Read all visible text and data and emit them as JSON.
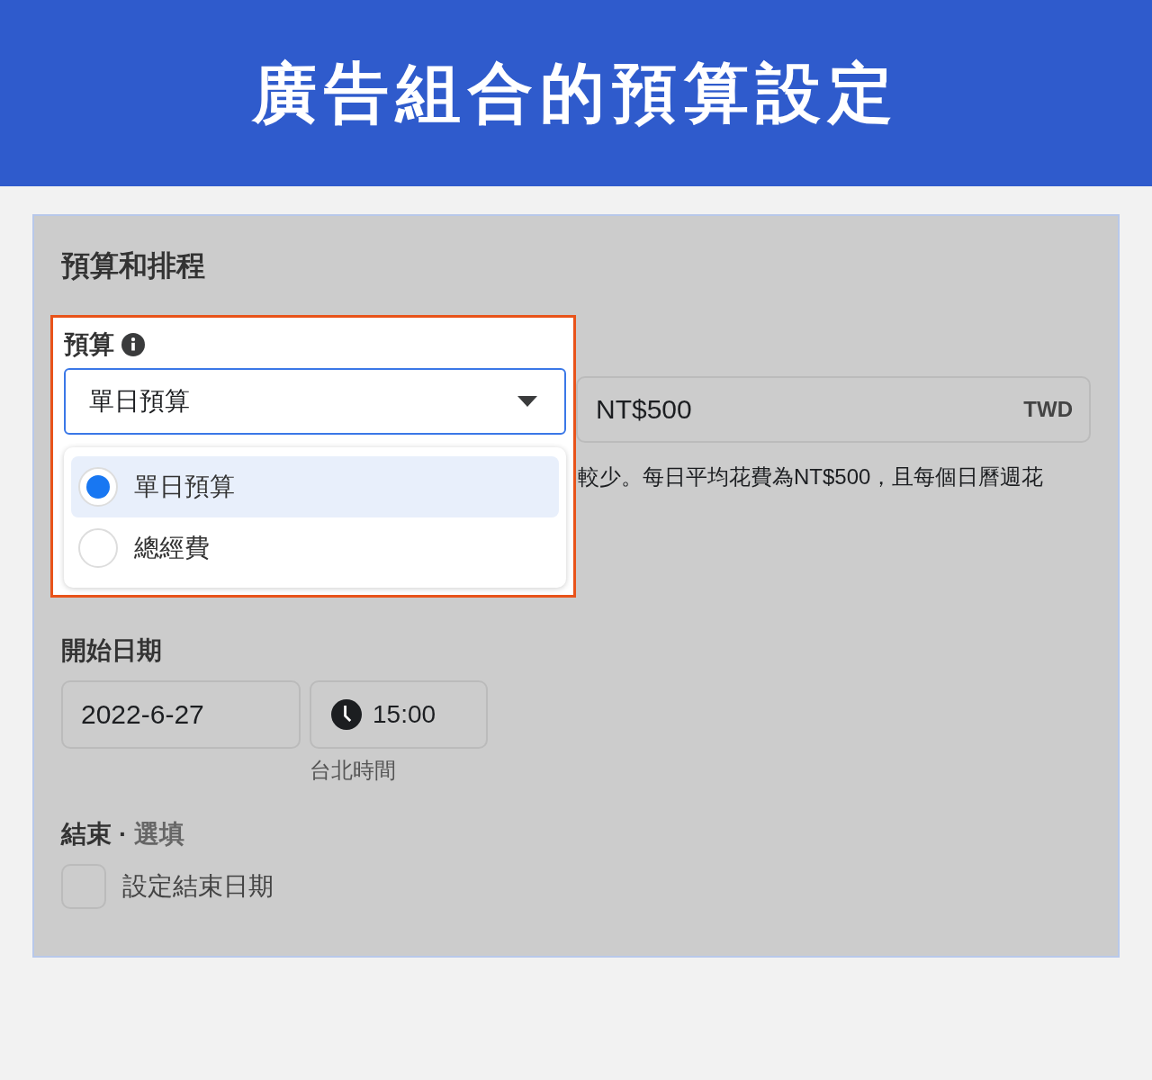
{
  "header": {
    "title": "廣告組合的預算設定"
  },
  "section": {
    "title": "預算和排程"
  },
  "budget": {
    "label": "預算",
    "select_value": "單日預算",
    "options": [
      {
        "label": "單日預算",
        "selected": true
      },
      {
        "label": "總經費",
        "selected": false
      }
    ],
    "amount": "NT$500",
    "currency": "TWD",
    "description": "較少。每日平均花費為NT$500，且每個日曆週花"
  },
  "start": {
    "label": "開始日期",
    "date": "2022-6-27",
    "time": "15:00",
    "timezone": "台北時間"
  },
  "end": {
    "label": "結束",
    "separator": "·",
    "optional": "選填",
    "checkbox": {
      "label": "設定結束日期",
      "checked": false
    }
  }
}
